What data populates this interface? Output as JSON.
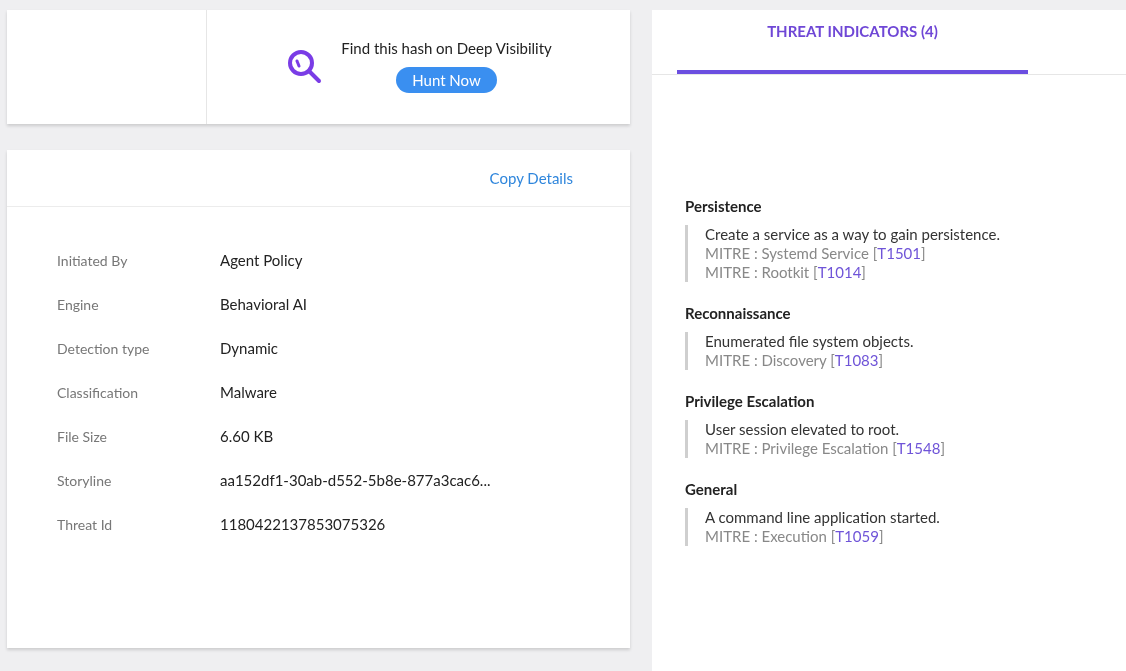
{
  "hunt": {
    "text": "Find this hash on Deep Visibility",
    "button": "Hunt Now"
  },
  "details": {
    "copy_link": "Copy Details",
    "rows": [
      {
        "label": "Initiated By",
        "value": "Agent Policy"
      },
      {
        "label": "Engine",
        "value": "Behavioral AI"
      },
      {
        "label": "Detection type",
        "value": "Dynamic"
      },
      {
        "label": "Classification",
        "value": "Malware"
      },
      {
        "label": "File Size",
        "value": "6.60 KB"
      },
      {
        "label": "Storyline",
        "value": "aa152df1-30ab-d552-5b8e-877a3cac6..."
      },
      {
        "label": "Threat Id",
        "value": "1180422137853075326"
      }
    ]
  },
  "tabs": [
    {
      "label": "THREAT INDICATORS (4)",
      "selected": true
    }
  ],
  "indicators": [
    {
      "title": "Persistence",
      "description": "Create a service as a way to gain persistence.",
      "mitre": [
        {
          "text": "MITRE : Systemd Service [",
          "link": "T1501",
          "tail": "]"
        },
        {
          "text": "MITRE : Rootkit [",
          "link": "T1014",
          "tail": "]"
        }
      ]
    },
    {
      "title": "Reconnaissance",
      "description": "Enumerated file system objects.",
      "mitre": [
        {
          "text": "MITRE : Discovery [",
          "link": "T1083",
          "tail": "]"
        }
      ]
    },
    {
      "title": "Privilege Escalation",
      "description": "User session elevated to root.",
      "mitre": [
        {
          "text": "MITRE : Privilege Escalation [",
          "link": "T1548",
          "tail": "]"
        }
      ]
    },
    {
      "title": "General",
      "description": "A command line application started.",
      "mitre": [
        {
          "text": "MITRE : Execution [",
          "link": "T1059",
          "tail": "]"
        }
      ]
    }
  ]
}
